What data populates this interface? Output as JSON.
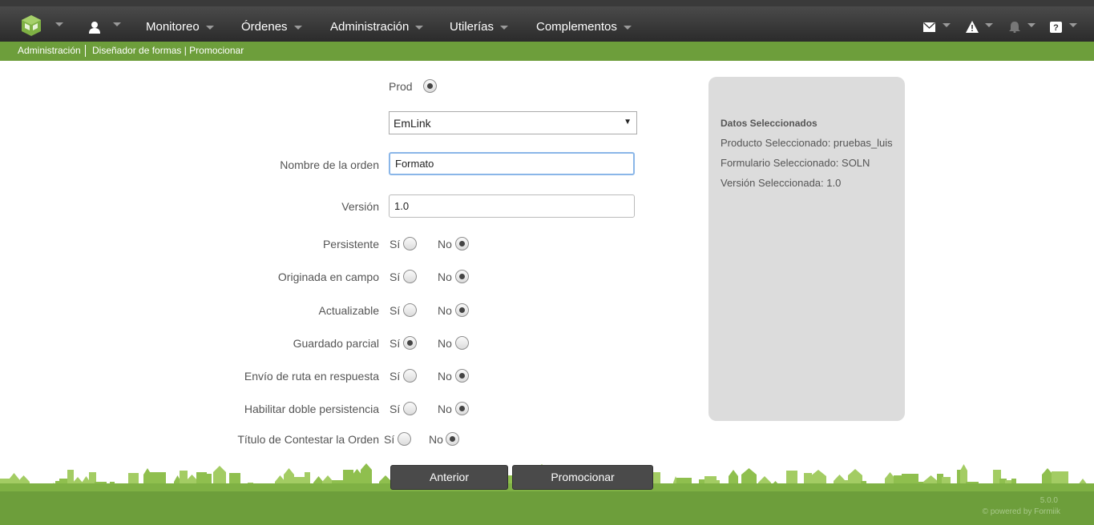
{
  "nav": {
    "items": [
      "Monitoreo",
      "Órdenes",
      "Administración",
      "Utilerías",
      "Complementos"
    ]
  },
  "breadcrumb": {
    "first": "Administración",
    "second": "Diseñador de formas | Promocionar"
  },
  "form": {
    "env_label": "Prod",
    "product_select": "EmLink",
    "order_name_label": "Nombre de la orden",
    "order_name_value": "Formato",
    "version_label": "Versión",
    "version_value": "1.0",
    "yes": "Sí",
    "no": "No",
    "options": [
      {
        "label": "Persistente",
        "selected": "No"
      },
      {
        "label": "Originada en campo",
        "selected": "No"
      },
      {
        "label": "Actualizable",
        "selected": "No"
      },
      {
        "label": "Guardado parcial",
        "selected": "Sí"
      },
      {
        "label": "Envío de ruta en respuesta",
        "selected": "No"
      },
      {
        "label": "Habilitar doble persistencia",
        "selected": "No"
      },
      {
        "label": "Título de Contestar la Orden",
        "selected": "No"
      }
    ]
  },
  "panel": {
    "title": "Datos Seleccionados",
    "product": "Producto Seleccionado: pruebas_luis",
    "form": "Formulario Seleccionado: SOLN",
    "version": "Versión Seleccionada: 1.0"
  },
  "buttons": {
    "prev": "Anterior",
    "promote": "Promocionar"
  },
  "footer": {
    "version": "5.0.0",
    "powered": "© powered by Formiik"
  },
  "colors": {
    "brand_green": "#6d9e3b",
    "topbar": "#333333",
    "panel": "#dcdcdc"
  }
}
